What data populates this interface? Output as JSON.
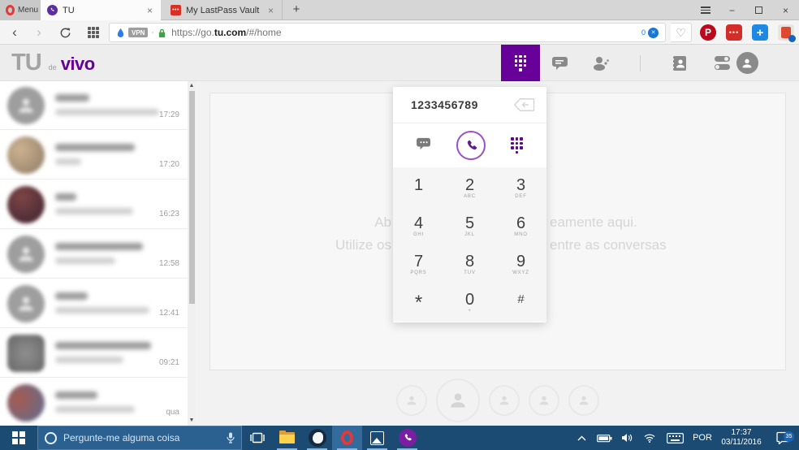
{
  "colors": {
    "accent_purple": "#660099",
    "taskbar_blue": "#1b4b73",
    "opera_red": "#e23a3a",
    "pinterest_red": "#bd081c",
    "lastpass_red": "#d32d27",
    "vpn_lock_green": "#43a047"
  },
  "browser": {
    "menu_label": "Menu",
    "tabs": [
      {
        "title": "TU"
      },
      {
        "title": "My LastPass Vault"
      }
    ],
    "tab_close_glyph": "×",
    "new_tab_glyph": "+",
    "minimize_glyph": "−",
    "close_glyph": "×",
    "vpn_label": "VPN",
    "sep_dot": "·",
    "url_scheme": "https://go.",
    "url_domain": "tu.com",
    "url_path": "/#/home",
    "blocked_count": "0",
    "heart_glyph": "♡",
    "pinterest_glyph": "P",
    "lastpass_glyph": "•••",
    "plus_ext_glyph": "+"
  },
  "app_header": {
    "logo_tu": "TU",
    "logo_de": "de",
    "logo_vivo": "vivo"
  },
  "dialpad": {
    "number": "1233456789",
    "keys": [
      {
        "d": "1",
        "l": ""
      },
      {
        "d": "2",
        "l": "ABC"
      },
      {
        "d": "3",
        "l": "DEF"
      },
      {
        "d": "4",
        "l": "GHI"
      },
      {
        "d": "5",
        "l": "JKL"
      },
      {
        "d": "6",
        "l": "MNO"
      },
      {
        "d": "7",
        "l": "PQRS"
      },
      {
        "d": "8",
        "l": "TUV"
      },
      {
        "d": "9",
        "l": "WXYZ"
      },
      {
        "d": "*",
        "l": ""
      },
      {
        "d": "0",
        "l": "+"
      },
      {
        "d": "#",
        "l": ""
      }
    ]
  },
  "sidebar": {
    "items": [
      {
        "time": "17:29"
      },
      {
        "time": "17:20"
      },
      {
        "time": "16:23"
      },
      {
        "time": "12:58"
      },
      {
        "time": "12:41"
      },
      {
        "time": "09:21"
      },
      {
        "time": "qua"
      }
    ],
    "scroll_up_glyph": "▲",
    "scroll_down_glyph": "▼"
  },
  "main_empty": {
    "line1_left": "Ab",
    "line1_right": "eamente aqui.",
    "line2_left": "Utilize os",
    "line2_right": "entre as conversas"
  },
  "taskbar": {
    "search_placeholder": "Pergunte-me alguma coisa",
    "language": "POR",
    "time": "17:37",
    "date": "03/11/2016",
    "notification_badge": "35"
  }
}
